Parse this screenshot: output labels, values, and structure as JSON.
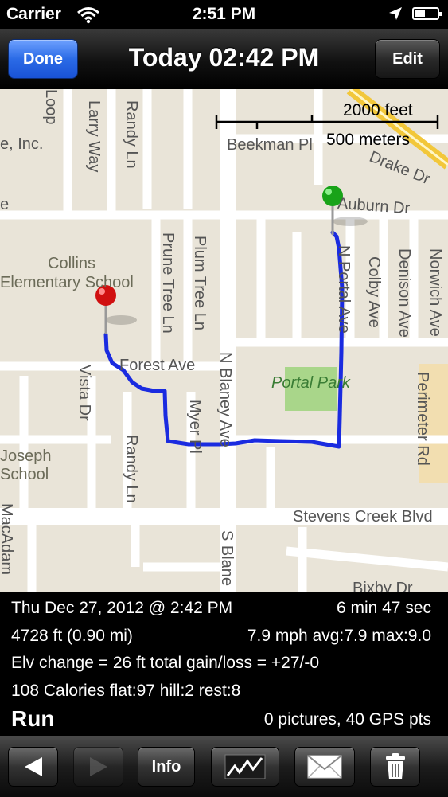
{
  "status": {
    "carrier": "Carrier",
    "time": "2:51 PM"
  },
  "nav": {
    "done_label": "Done",
    "title": "Today 02:42 PM",
    "edit_label": "Edit"
  },
  "map": {
    "scale": {
      "feet": "2000 feet",
      "meters": "500 meters"
    },
    "labels": {
      "loop": "Loop",
      "inc": "e, Inc.",
      "e": "e",
      "larry_way": "Larry Way",
      "randy_ln_top": "Randy Ln",
      "beekman": "Beekman Pl",
      "drake": "Drake Dr",
      "auburn": "Auburn Dr",
      "collins": "Collins",
      "elementary": "Elementary School",
      "prune_tree": "Prune Tree Ln",
      "plum_tree": "Plum Tree Ln",
      "n_portal": "N Portal Ave",
      "colby": "Colby Ave",
      "denison": "Denison Ave",
      "norwich": "Norwich Ave",
      "forest": "Forest Ave",
      "n_blaney": "N Blaney Ave",
      "portal_park": "Portal Park",
      "vista": "Vista Dr",
      "myer": "Myer Pl",
      "perimeter": "Perimeter Rd",
      "joseph": "Joseph",
      "school": "School",
      "randy_ln_bottom": "Randy Ln",
      "stevens_creek": "Stevens Creek Blvd",
      "macadam": "MacAdam",
      "s_blaney": "S Blane",
      "bixby": "Bixby Dr"
    }
  },
  "info": {
    "date": "Thu Dec 27, 2012 @ 2:42 PM",
    "duration": "6 min 47 sec",
    "distance": "4728 ft (0.90 mi)",
    "speed": "7.9 mph avg:7.9 max:9.0",
    "elevation": "Elv change = 26 ft total gain/loss = +27/-0",
    "calories": "108 Calories flat:97 hill:2 rest:8",
    "activity": "Run",
    "counts": "0 pictures, 40 GPS pts"
  },
  "toolbar": {
    "info_label": "Info"
  },
  "colors": {
    "route": "#1a2be0",
    "start_pin": "#19a319",
    "end_pin": "#d01010",
    "park": "#a9d68a"
  }
}
